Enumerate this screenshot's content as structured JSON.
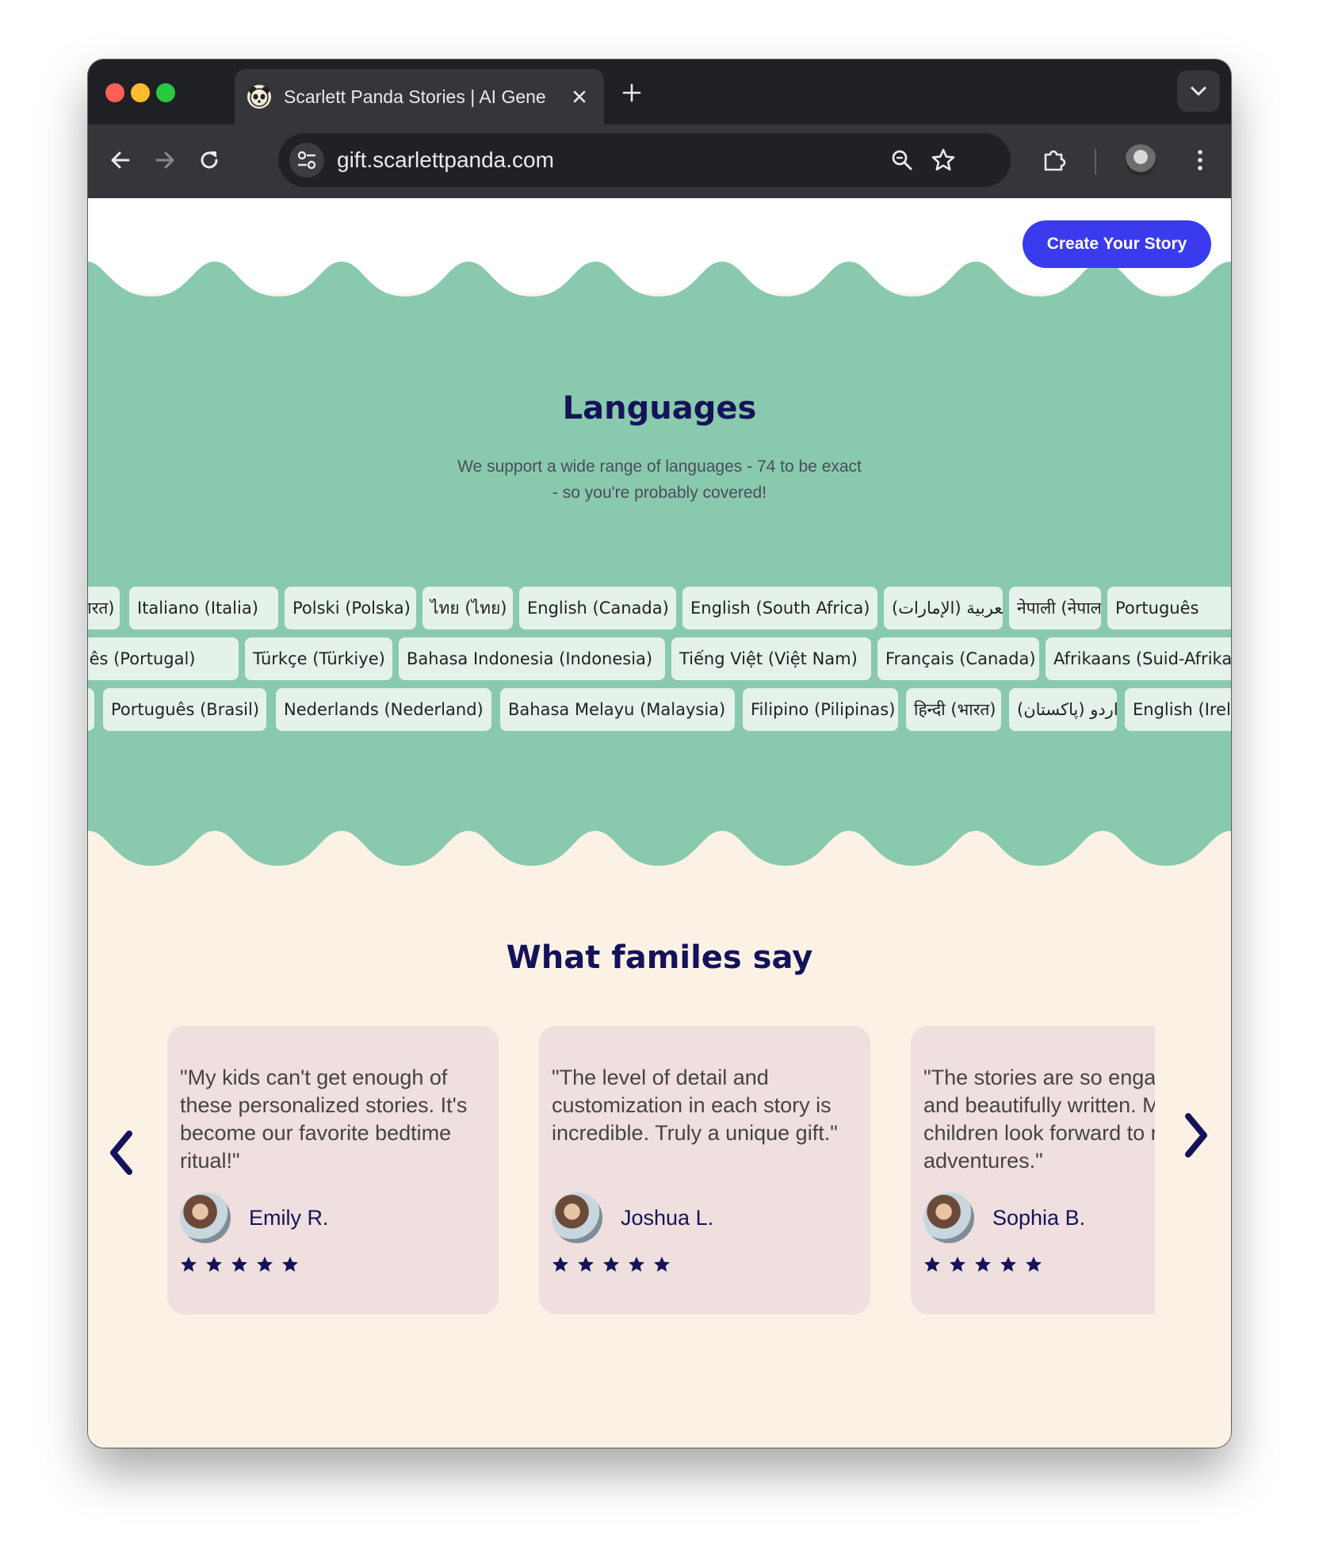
{
  "browser": {
    "tab_title": "Scarlett Panda Stories | AI Generated",
    "url": "gift.scarlettpanda.com"
  },
  "header": {
    "cta_label": "Create Your Story"
  },
  "languages": {
    "title": "Languages",
    "subtitle": "We support a wide range of languages - 74 to be exact - so you're probably covered!",
    "row1": [
      "हिन्दी (भारत)",
      "Italiano (Italia)",
      "Polski (Polska)",
      "ไทย (ไทย)",
      "English (Canada)",
      "English (South Africa)",
      "العربية (الإمارات)",
      "नेपाली (नेपाल)",
      "Português"
    ],
    "row2": [
      "Português (Portugal)",
      "Türkçe (Türkiye)",
      "Bahasa Indonesia (Indonesia)",
      "Tiếng Việt (Việt Nam)",
      "Français (Canada)",
      "Afrikaans (Suid-Afrika)"
    ],
    "row3": [
      "",
      "Português (Brasil)",
      "Nederlands (Nederland)",
      "Bahasa Melayu (Malaysia)",
      "Filipino (Pilipinas)",
      "हिन्दी (भारत)",
      "اردو (پاکستان)",
      "English (Ireland)"
    ]
  },
  "testimonials": {
    "title": "What familes say",
    "items": [
      {
        "quote": "\"My kids can't get enough of these personalized stories. It's become our favorite bedtime ritual!\"",
        "name": "Emily R.",
        "rating": 5
      },
      {
        "quote": "\"The level of detail and customization in each story is incredible. Truly a unique gift.\"",
        "name": "Joshua L.",
        "rating": 5
      },
      {
        "quote": "\"The stories are so engaging and beautifully written. My children look forward to new adventures.\"",
        "name": "Sophia B.",
        "rating": 5
      }
    ]
  },
  "colors": {
    "teal": "#89c9ad",
    "cream": "#fbf2e5",
    "navy": "#14135a",
    "cta_blue": "#3a3aef",
    "card_pink": "#efdfde",
    "chip_bg": "#e4f2ea"
  }
}
